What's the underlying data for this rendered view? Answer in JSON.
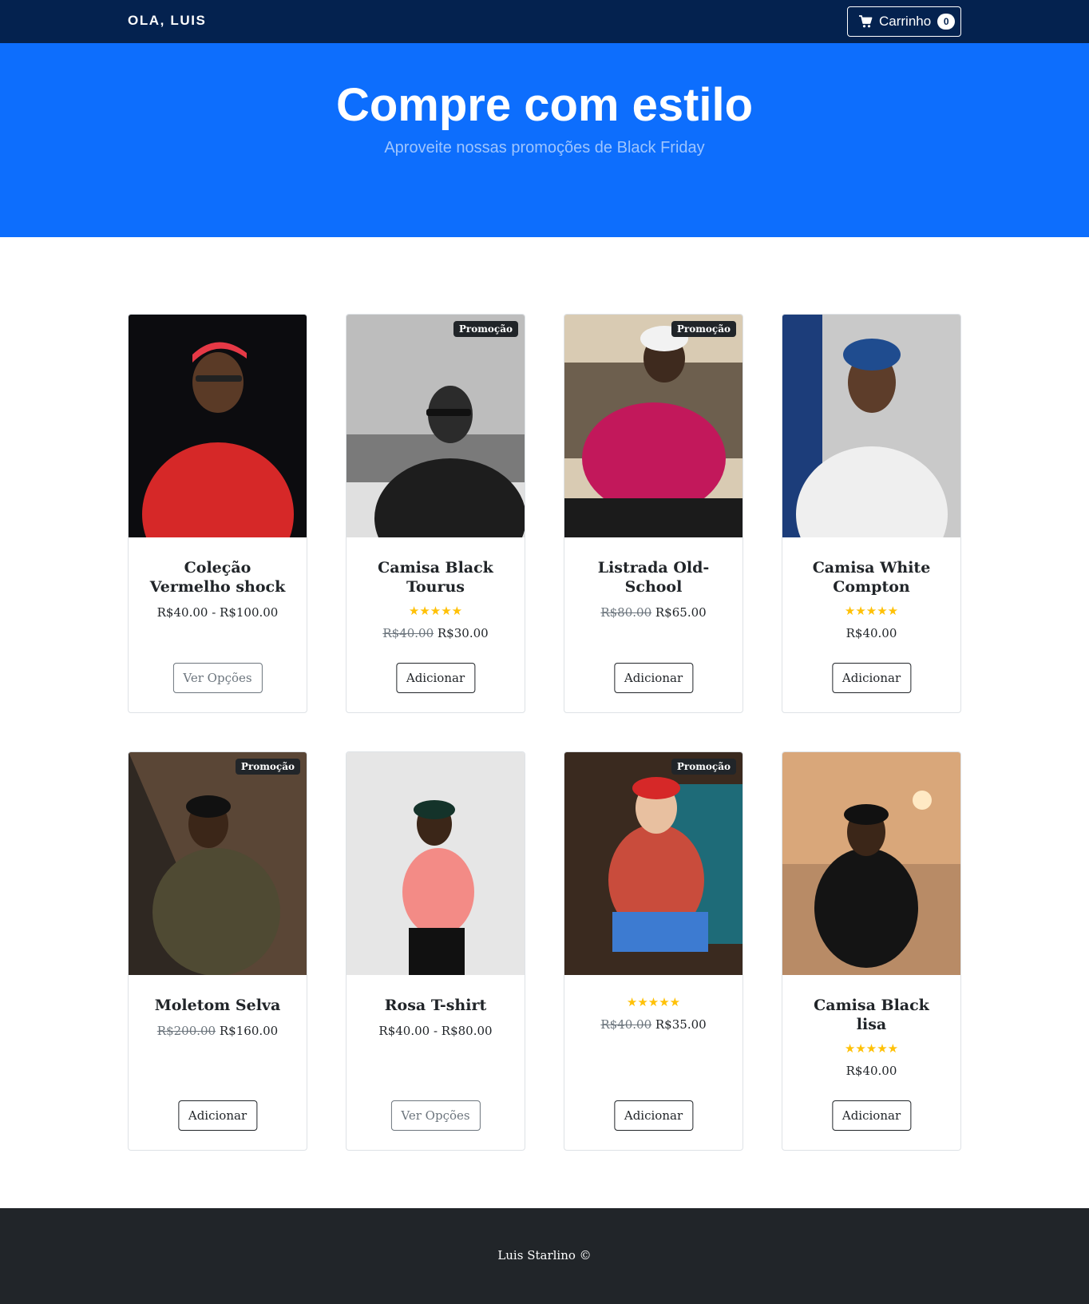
{
  "navbar": {
    "brand": "OLA, LUIS",
    "cart_label": "Carrinho",
    "cart_count": "0",
    "cart_icon": "cart-icon"
  },
  "hero": {
    "title": "Compre com estilo",
    "subtitle": "Aproveite nossas promoções de Black Friday"
  },
  "products": [
    {
      "name": "Coleção Vermelho shock",
      "sale": "",
      "rating": "",
      "old_price": "",
      "price": "R$40.00 - R$100.00",
      "button": "Ver Opções"
    },
    {
      "name": "Camisa Black Tourus",
      "sale": "Promoção",
      "rating": "★★★★★",
      "old_price": "R$40.00",
      "price": "R$30.00",
      "button": "Adicionar"
    },
    {
      "name": "Listrada Old-School",
      "sale": "Promoção",
      "rating": "",
      "old_price": "R$80.00",
      "price": "R$65.00",
      "button": "Adicionar"
    },
    {
      "name": "Camisa White Compton",
      "sale": "",
      "rating": "★★★★★",
      "old_price": "",
      "price": "R$40.00",
      "button": "Adicionar"
    },
    {
      "name": "Moletom Selva",
      "sale": "Promoção",
      "rating": "",
      "old_price": "R$200.00",
      "price": "R$160.00",
      "button": "Adicionar"
    },
    {
      "name": "Rosa T-shirt",
      "sale": "",
      "rating": "",
      "old_price": "",
      "price": "R$40.00 - R$80.00",
      "button": "Ver Opções"
    },
    {
      "name": "",
      "sale": "Promoção",
      "rating": "★★★★★",
      "old_price": "R$40.00",
      "price": "R$35.00",
      "button": "Adicionar"
    },
    {
      "name": "Camisa Black lisa",
      "sale": "",
      "rating": "★★★★★",
      "old_price": "",
      "price": "R$40.00",
      "button": "Adicionar"
    }
  ],
  "footer": {
    "text": "Luis Starlino ©"
  },
  "colors": {
    "navbar": "#04224f",
    "hero": "#0d6efd",
    "footer": "#212529",
    "star": "#ffc107"
  }
}
